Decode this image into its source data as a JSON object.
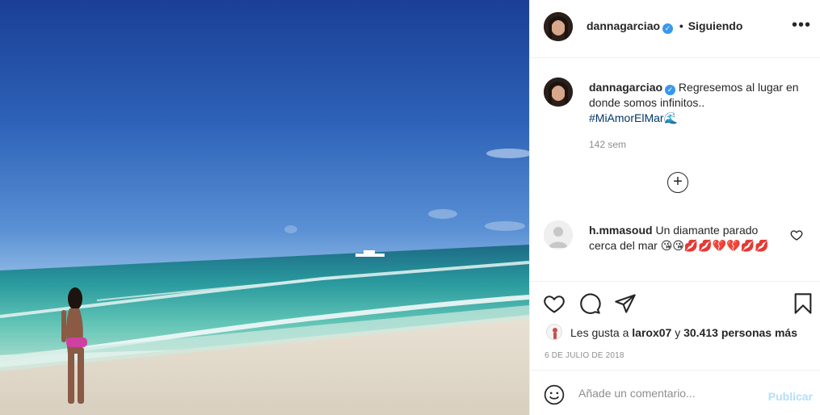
{
  "post": {
    "username": "dannagarciao",
    "verified_mark": "✓",
    "separator": "•",
    "follow_status": "Siguiendo",
    "more_glyph": "•••",
    "caption_text": "Regresemos al lugar en donde somos infinitos..",
    "hashtag": "#MiAmorElMar",
    "caption_emoji": "🌊",
    "caption_time": "142 sem",
    "load_more_glyph": "+"
  },
  "comment": {
    "username": "h.mmasoud",
    "text": "Un diamante parado cerca del mar",
    "emojis": "😘😘💋💋💔💔💋💋"
  },
  "likes": {
    "prefix": "Les gusta a",
    "user": "larox07",
    "connector": "y",
    "count": "30.413 personas más"
  },
  "date": "6 DE JULIO DE 2018",
  "compose": {
    "placeholder": "Añade un comentario...",
    "publish_label": "Publicar"
  },
  "icons": {
    "like": "heart-icon",
    "comment": "comment-icon",
    "share": "share-icon",
    "save": "bookmark-icon",
    "emoji": "emoji-icon"
  },
  "colors": {
    "verified": "#3897f0",
    "hashtag": "#00376b",
    "publish_disabled": "#b2dffc",
    "muted": "#8e8e8e"
  }
}
